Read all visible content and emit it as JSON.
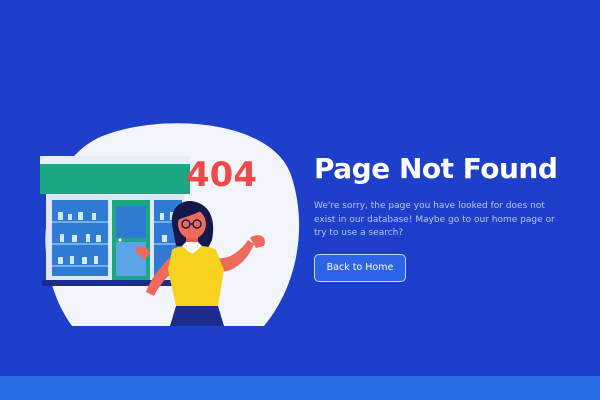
{
  "error": {
    "code": "404",
    "title": "Page Not Found",
    "message": "We're sorry, the page you have looked for does not exist in our database! Maybe go to our home page or try to use a search?"
  },
  "actions": {
    "back_label": "Back to Home"
  },
  "colors": {
    "background": "#1e3fc9",
    "footer": "#2a6ee6",
    "accent_red": "#ef4a4a",
    "shop_green": "#1aa782",
    "shirt_yellow": "#f4d21e"
  },
  "illustration": {
    "icon": "shopkeeper-illustration"
  }
}
